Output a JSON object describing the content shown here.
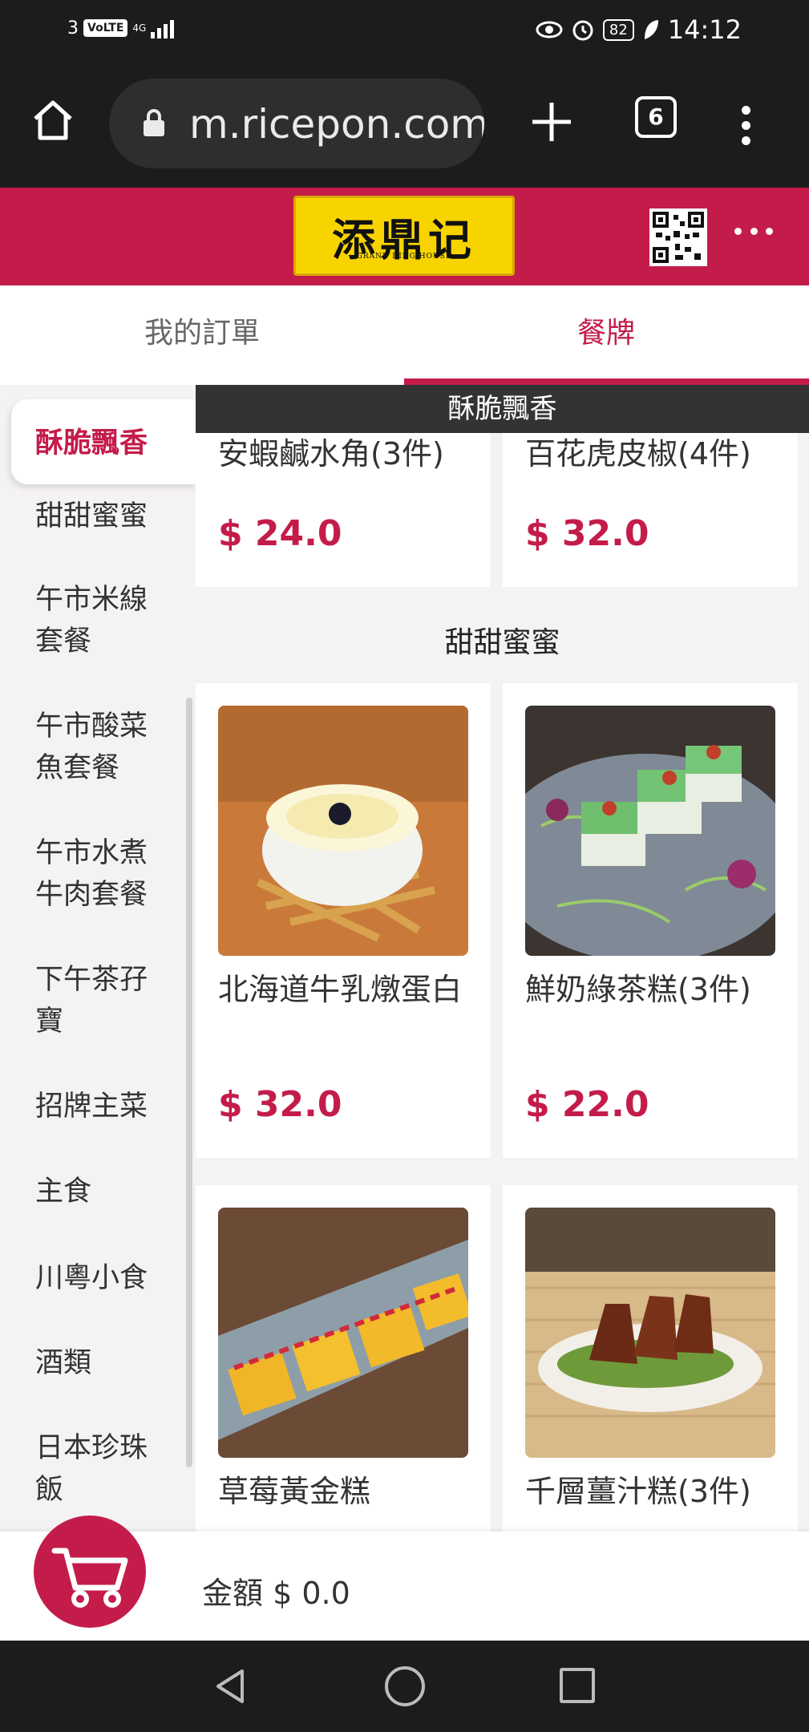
{
  "status_bar": {
    "sim": "3",
    "volte": "VoLTE",
    "network": "4G",
    "battery": "82",
    "time": "14:12"
  },
  "browser": {
    "url": "m.ricepon.com/",
    "tab_count": "6"
  },
  "header": {
    "logo_cn": "添鼎记",
    "logo_en": "GRAND DING HOUSE"
  },
  "tabs": {
    "orders": "我的訂單",
    "menu": "餐牌"
  },
  "sidebar": {
    "active": "酥脆飄香",
    "items": [
      "甜甜蜜蜜",
      "午市米線套餐",
      "午市酸菜魚套餐",
      "午市水煮牛肉套餐",
      "下午茶孖寶",
      "招牌主菜",
      "主食",
      "川粵小食",
      "酒類",
      "日本珍珠飯"
    ]
  },
  "content": {
    "sticky_category": "酥脆飄香",
    "section1_items": [
      {
        "name": "安蝦鹹水角(3件)",
        "price": "$ 24.0"
      },
      {
        "name": "百花虎皮椒(4件)",
        "price": "$ 32.0"
      }
    ],
    "section2_title": "甜甜蜜蜜",
    "section2_items": [
      {
        "name": "北海道牛乳燉蛋白",
        "price": "$ 32.0"
      },
      {
        "name": "鮮奶綠茶糕(3件)",
        "price": "$ 22.0"
      },
      {
        "name": "草莓黃金糕",
        "price": ""
      },
      {
        "name": "千層薑汁糕(3件)",
        "price": ""
      }
    ]
  },
  "cart": {
    "total": "金額 $ 0.0"
  },
  "colors": {
    "brand": "#c41c4a",
    "dark": "#1c1c1c"
  }
}
